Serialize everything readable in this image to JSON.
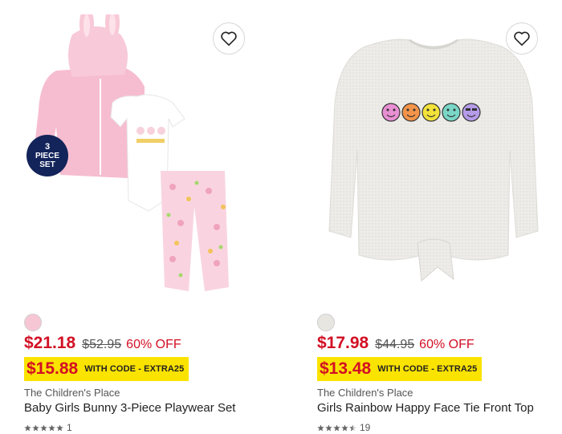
{
  "products": [
    {
      "swatch_color": "#f7c6d4",
      "price": "$21.18",
      "was_price": "$52.95",
      "discount": "60% OFF",
      "promo_price": "$15.88",
      "promo_code": "WITH CODE - EXTRA25",
      "brand": "The Children's Place",
      "title": "Baby Girls Bunny 3-Piece Playwear Set",
      "rating": 5,
      "review_count": "1",
      "badge": {
        "line1": "3",
        "line2": "PIECE",
        "line3": "SET"
      }
    },
    {
      "swatch_color": "#e8e6e1",
      "price": "$17.98",
      "was_price": "$44.95",
      "discount": "60% OFF",
      "promo_price": "$13.48",
      "promo_code": "WITH CODE - EXTRA25",
      "brand": "The Children's Place",
      "title": "Girls Rainbow Happy Face Tie Front Top",
      "rating": 4.5,
      "review_count": "19"
    }
  ],
  "colors": {
    "sale_red": "#d20f24",
    "promo_yellow": "#fbe300",
    "badge_navy": "#13245a"
  },
  "icons": {
    "wishlist": "heart-outline-icon",
    "rating": "star-icon"
  }
}
